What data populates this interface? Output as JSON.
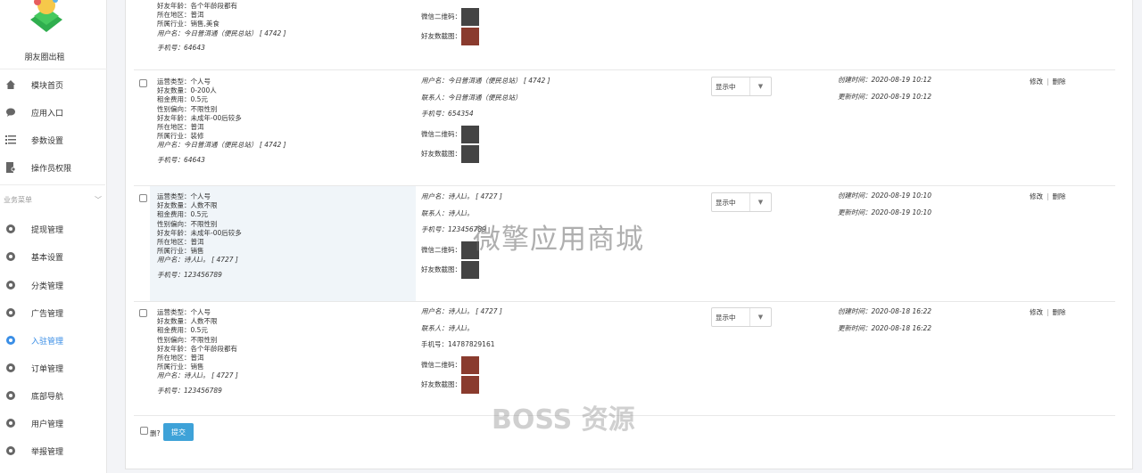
{
  "sidebar": {
    "app_name": "朋友圈出租",
    "items": [
      {
        "label": "模块首页",
        "icon": "home-icon"
      },
      {
        "label": "应用入口",
        "icon": "chat-icon"
      },
      {
        "label": "参数设置",
        "icon": "list-icon"
      },
      {
        "label": "操作员权限",
        "icon": "file-user-icon"
      }
    ],
    "group_label": "业务菜单",
    "group_items": [
      {
        "label": "提现管理"
      },
      {
        "label": "基本设置"
      },
      {
        "label": "分类管理"
      },
      {
        "label": "广告管理"
      },
      {
        "label": "入驻管理"
      },
      {
        "label": "订单管理"
      },
      {
        "label": "底部导航"
      },
      {
        "label": "用户管理"
      },
      {
        "label": "举报管理"
      }
    ],
    "accent_color": "#3a8ee6"
  },
  "top_partial": {
    "lines": [
      "好友年龄：各个年龄段都有",
      "所在地区：普洱",
      "所属行业：销售,美食"
    ],
    "username": "用户名：今日普洱通（便民总站）",
    "user_id": "[ 4742 ]",
    "phone": "手机号：64643",
    "wx_qr": "微信二维码：",
    "friend_shot": "好友数截图："
  },
  "rows": [
    {
      "details": [
        "运营类型：个人号",
        "好友数量：0-200人",
        "租金费用：0.5元",
        "性别偏向：不限性别",
        "好友年龄：未成年-00后较多",
        "所在地区：普洱",
        "所属行业：装修"
      ],
      "username": "用户名：今日普洱通（便民总站）",
      "user_id": "[ 4742 ]",
      "phone": "手机号：64643",
      "c_username": "用户名：今日普洱通（便民总站）",
      "c_user_id": "[ 4742 ]",
      "c_contact": "联系人：今日普洱通（便民总站）",
      "c_phone": "手机号：654354",
      "wx_qr": "微信二维码：",
      "friend_shot": "好友数截图：",
      "status": "显示中",
      "created": "创建时间：2020-08-19 10:12",
      "updated": "更新时间：2020-08-19 10:12",
      "edit": "修改",
      "delete": "删除"
    },
    {
      "details": [
        "运营类型：个人号",
        "好友数量：人数不限",
        "租金费用：0.5元",
        "性别偏向：不限性别",
        "好友年龄：未成年-00后较多",
        "所在地区：普洱",
        "所属行业：销售"
      ],
      "username": "用户名：诗人Li。",
      "user_id": "[ 4727 ]",
      "phone": "手机号：123456789",
      "c_username": "用户名：诗人Li。",
      "c_user_id": "[ 4727 ]",
      "c_contact": "联系人：诗人Li。",
      "c_phone": "手机号：123456789",
      "wx_qr": "微信二维码：",
      "friend_shot": "好友数截图：",
      "status": "显示中",
      "created": "创建时间：2020-08-19 10:10",
      "updated": "更新时间：2020-08-19 10:10",
      "edit": "修改",
      "delete": "删除"
    },
    {
      "details": [
        "运营类型：个人号",
        "好友数量：人数不限",
        "租金费用：0.5元",
        "性别偏向：不限性别",
        "好友年龄：各个年龄段都有",
        "所在地区：普洱",
        "所属行业：销售"
      ],
      "username": "用户名：诗人Li。",
      "user_id": "[ 4727 ]",
      "phone": "手机号：123456789",
      "c_username": "用户名：诗人Li。",
      "c_user_id": "[ 4727 ]",
      "c_contact": "联系人：诗人Li。",
      "c_phone": "手机号：14787829161",
      "wx_qr": "微信二维码：",
      "friend_shot": "好友数截图：",
      "status": "显示中",
      "created": "创建时间：2020-08-18 16:22",
      "updated": "更新时间：2020-08-18 16:22",
      "edit": "修改",
      "delete": "删除"
    }
  ],
  "footer": {
    "delete_label": "删?",
    "submit_label": "提交"
  },
  "watermarks": {
    "top": "微擎应用商城",
    "bottom": "BOSS 资源"
  }
}
